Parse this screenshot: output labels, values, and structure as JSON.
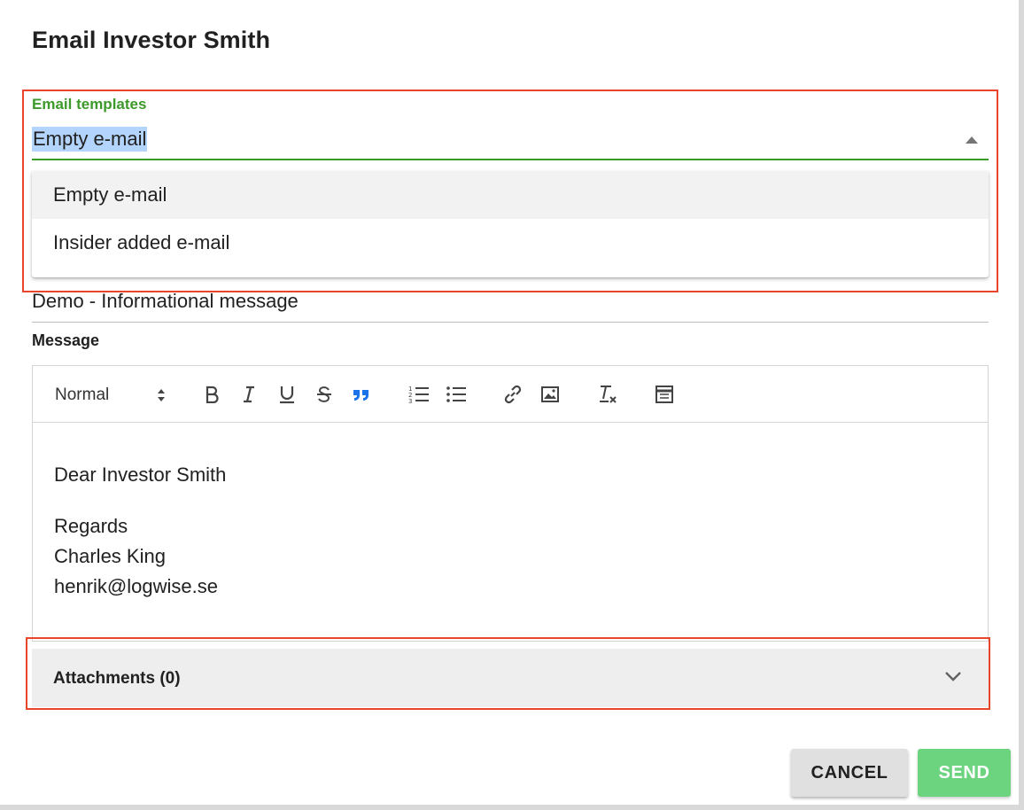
{
  "dialog": {
    "title": "Email Investor Smith"
  },
  "templates": {
    "label": "Email templates",
    "selected": "Empty e-mail",
    "options": [
      "Empty e-mail",
      "Insider added e-mail"
    ]
  },
  "subject": {
    "value": "Demo - Informational message"
  },
  "message": {
    "label": "Message",
    "toolbar": {
      "format": "Normal",
      "buttons": [
        "bold-icon",
        "italic-icon",
        "underline-icon",
        "strikethrough-icon",
        "blockquote-icon",
        "ordered-list-icon",
        "bullet-list-icon",
        "link-icon",
        "image-icon",
        "clear-format-icon",
        "table-icon"
      ]
    },
    "body": {
      "greeting": "Dear Investor Smith",
      "closing": "Regards",
      "name": "Charles King",
      "email": "henrik@logwise.se"
    }
  },
  "attachments": {
    "label": "Attachments (0)"
  },
  "actions": {
    "cancel": "CANCEL",
    "send": "SEND"
  },
  "colors": {
    "accent": "#3c9a2a",
    "highlight": "#e8452c",
    "send": "#6cd47f",
    "quote_icon": "#1a73e8"
  }
}
